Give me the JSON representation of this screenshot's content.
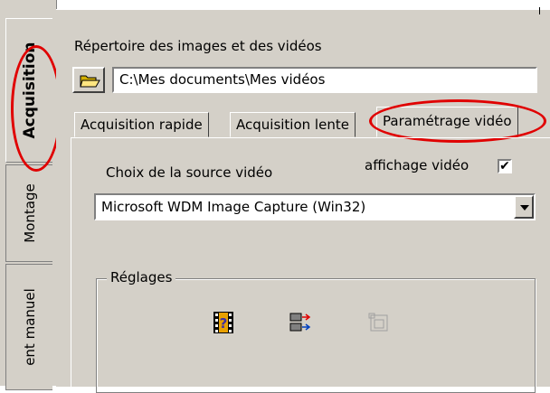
{
  "vertical_tabs": [
    {
      "label": "Acquisition",
      "active": true
    },
    {
      "label": "Montage",
      "active": false
    },
    {
      "label": "ent manuel",
      "active": false
    }
  ],
  "directory": {
    "label": "Répertoire des images et des vidéos",
    "path": "C:\\Mes documents\\Mes vidéos"
  },
  "tabs": [
    {
      "label": "Acquisition rapide",
      "active": false
    },
    {
      "label": "Acquisition lente",
      "active": false
    },
    {
      "label": "Paramétrage vidéo",
      "active": true
    }
  ],
  "video_settings": {
    "source_label": "Choix de la source vidéo",
    "display_label": "affichage vidéo",
    "display_checked": true,
    "check_mark": "✔",
    "source_selected": "Microsoft WDM Image Capture (Win32)"
  },
  "settings_group": {
    "label": "Réglages",
    "icons": [
      "video-format-icon",
      "video-source-icon",
      "video-display-icon"
    ]
  },
  "colors": {
    "highlight_ring": "#e00000",
    "window_bg": "#d4d0c8"
  }
}
